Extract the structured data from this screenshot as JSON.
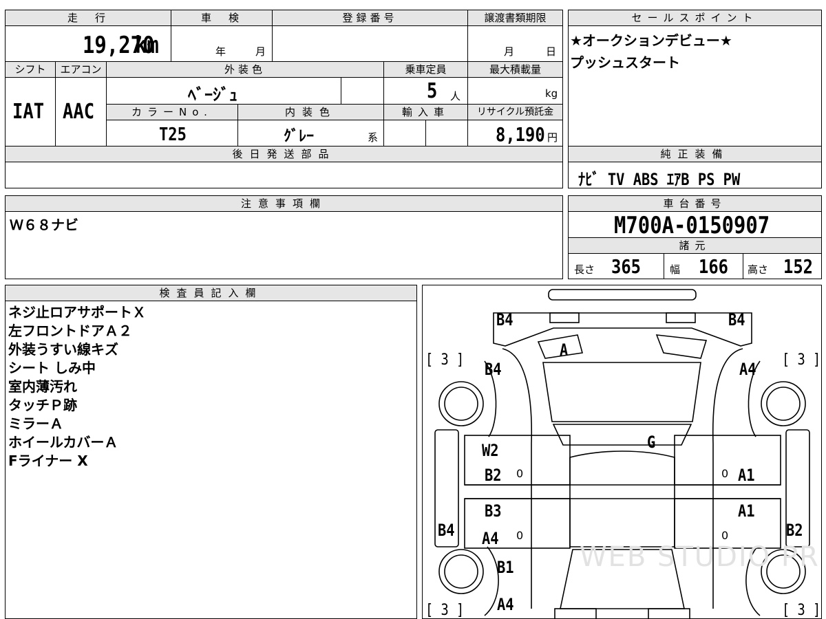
{
  "spec": {
    "mileage_label": "走　行",
    "mileage_value": "19,270",
    "mileage_unit": "km",
    "inspection_label": "車　検",
    "inspection_year": "年",
    "inspection_month": "月",
    "registration_label": "登録番号",
    "transfer_label": "譲渡書類期限",
    "transfer_month": "月",
    "transfer_day": "日",
    "shift_label": "シフト",
    "shift_value": "IAT",
    "aircon_label": "エアコン",
    "aircon_value": "AAC",
    "exterior_label": "外装色",
    "exterior_value": "ﾍﾞｰｼﾞｭ",
    "capacity_label": "乗車定員",
    "capacity_value": "5",
    "capacity_unit": "人",
    "maxload_label": "最大積載量",
    "maxload_unit": "kg",
    "colorno_label": "カラーNo.",
    "colorno_value": "T25",
    "interior_label": "内装色",
    "interior_value": "ｸﾞﾚｰ",
    "interior_unit": "系",
    "import_label": "輸入車",
    "recycle_label": "リサイクル預託金",
    "recycle_value": "8,190",
    "recycle_unit": "円",
    "later_parts_label": "後日発送部品"
  },
  "sales": {
    "label": "セールスポイント",
    "lines": [
      "★オークションデビュー★",
      "プッシュスタート"
    ]
  },
  "equipment": {
    "label": "純正装備",
    "value": "ﾅﾋﾞ TV ABS ｴｱB PS PW"
  },
  "notes": {
    "label": "注意事項欄",
    "value": "Ｗ６８ナビ"
  },
  "chassis": {
    "label": "車台番号",
    "value": "M700A-0150907",
    "dims_label": "諸元",
    "length_label": "長さ",
    "length_value": "365",
    "width_label": "幅",
    "width_value": "166",
    "height_label": "高さ",
    "height_value": "152"
  },
  "inspector": {
    "label": "検査員記入欄",
    "lines": [
      "ネジ止ロアサポートＸ",
      "左フロントドアＡ２",
      "外装うすい線キズ",
      "シート しみ中",
      "室内薄汚れ",
      "タッチＰ跡",
      "ミラーＡ",
      "ホイールカバーＡ",
      "Fライナー X"
    ]
  },
  "diagram": {
    "fl_tire": "[ 3 ]",
    "fr_tire": "[ 3 ]",
    "rl_tire": "[ 3 ]",
    "rr_tire": "[ 3 ]",
    "front_left_corner": "B4",
    "front_right_corner": "B4",
    "hood": "A",
    "left_fender": "B4",
    "right_fender": "A4",
    "roof": "G",
    "left_front_door_a": "W2",
    "left_front_door_b": "B2",
    "right_front_door": "A1",
    "left_rear_door_a": "B3",
    "left_rear_door_b": "A4",
    "right_rear_door": "A1",
    "left_sill": "B4",
    "right_sill": "B2",
    "left_rear_fender": "B1",
    "left_rear_bumper": "A4",
    "zero1": "0",
    "zero2": "0",
    "zero3": "0",
    "zero4": "0",
    "watermark": "WEB STUDIO PRO"
  }
}
